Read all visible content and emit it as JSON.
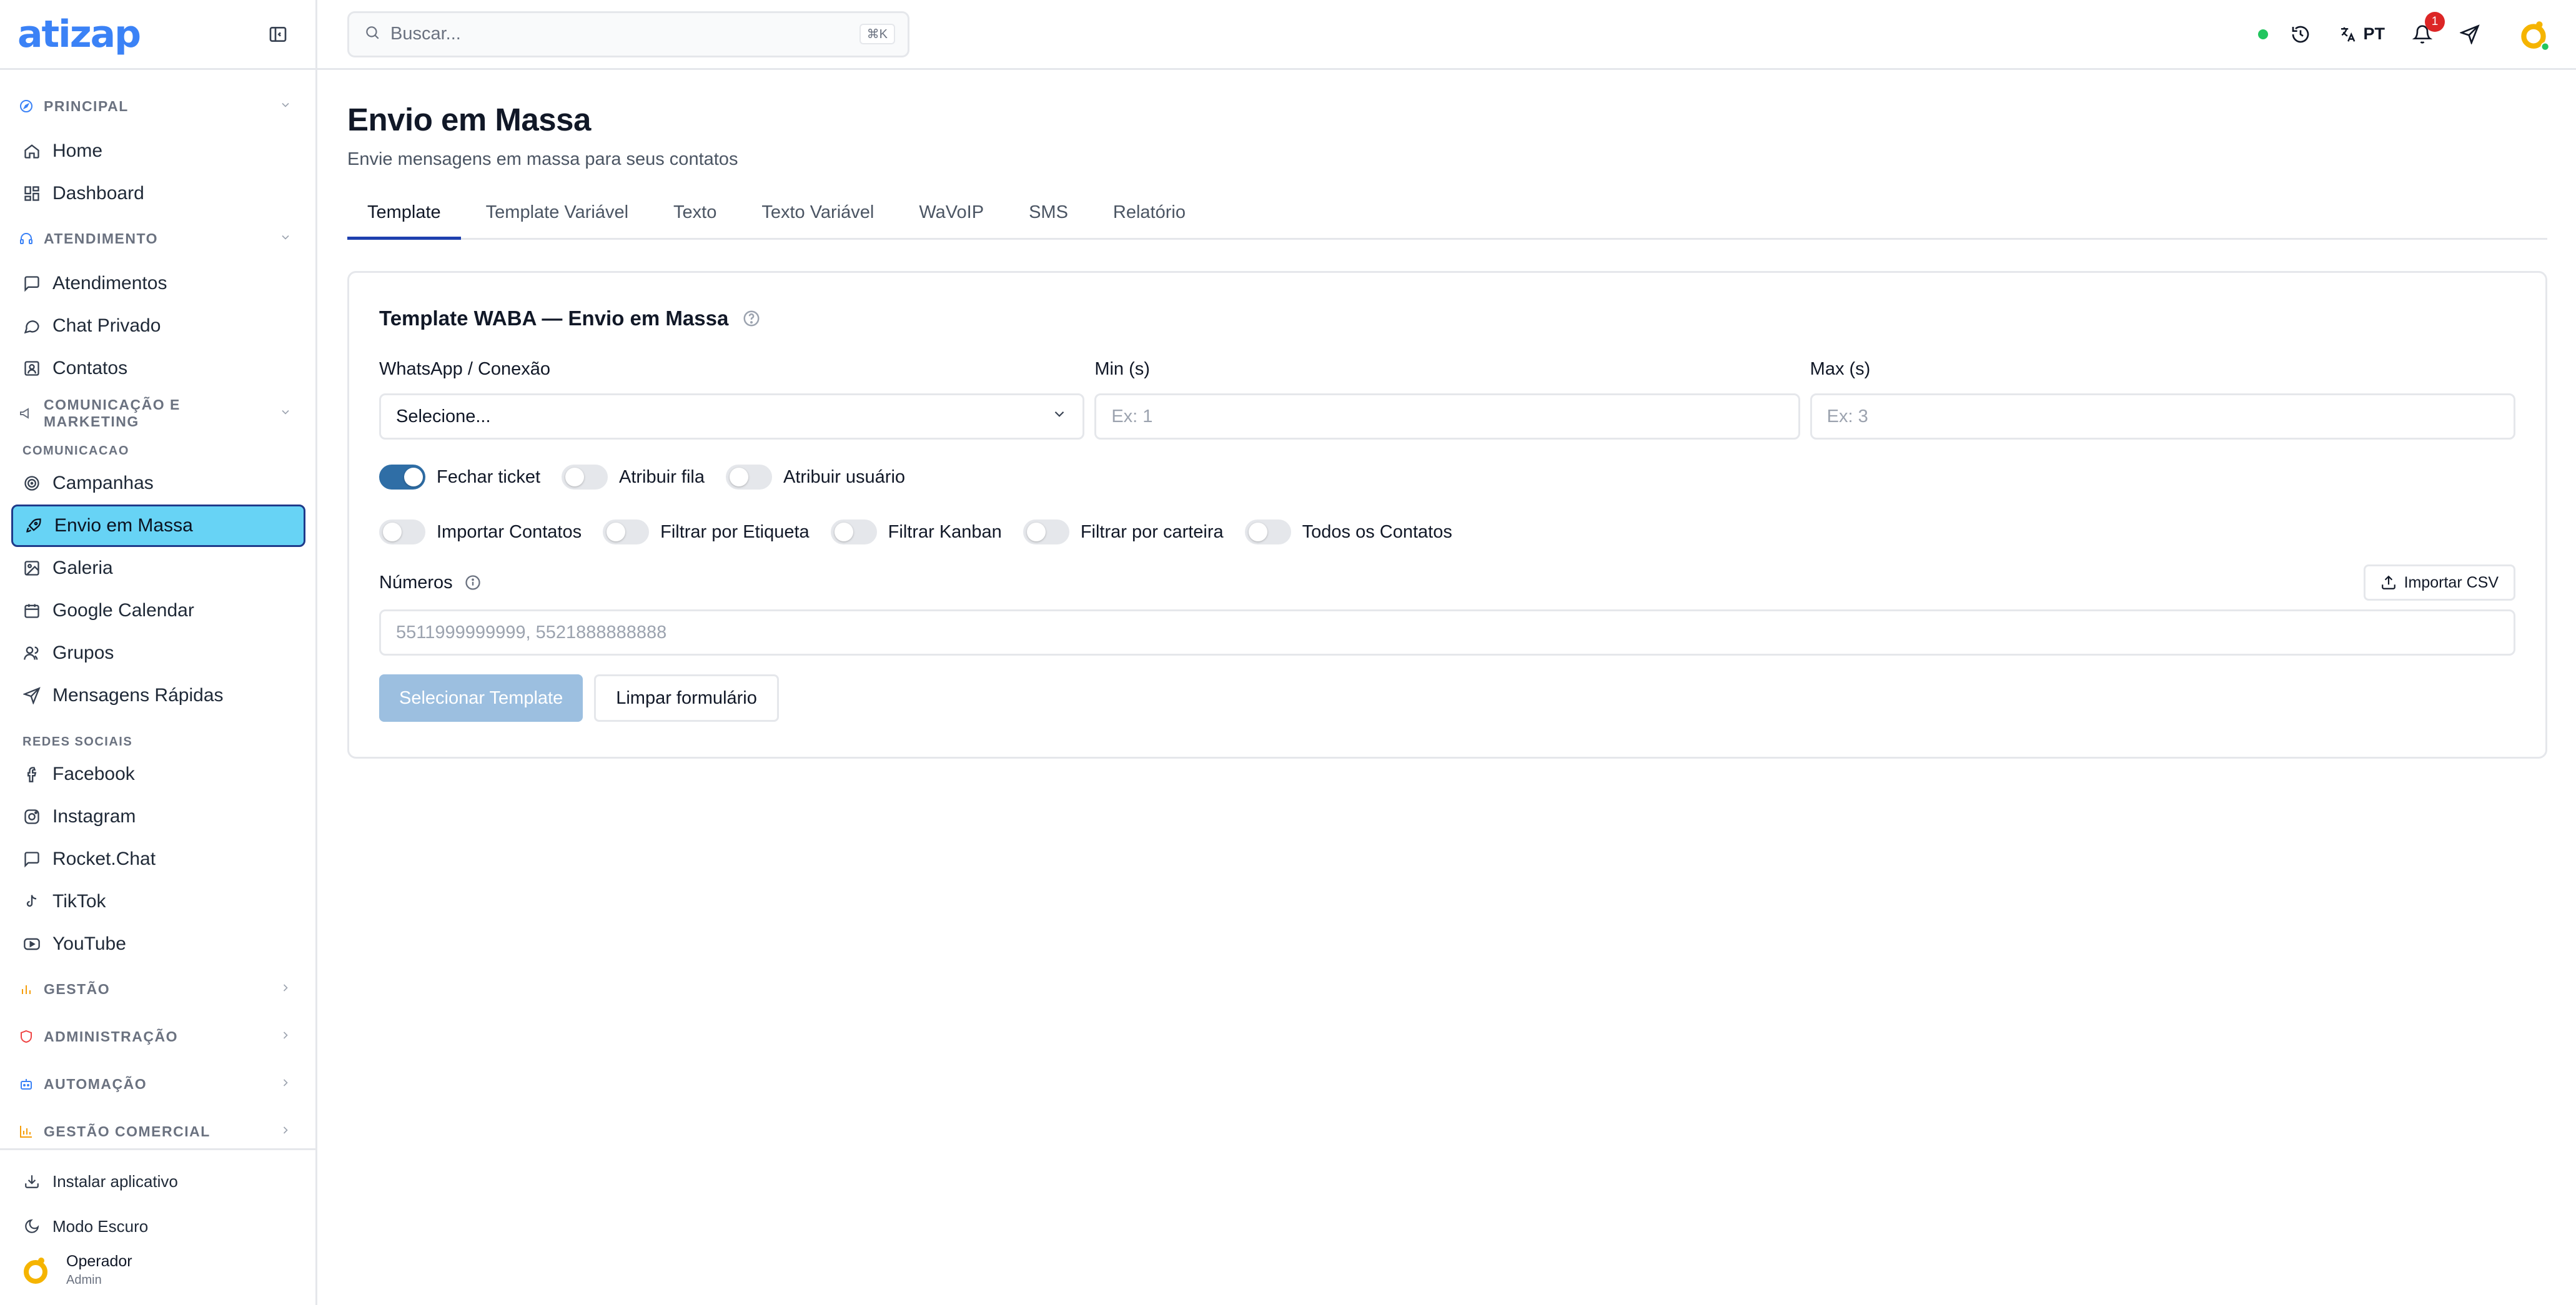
{
  "app": {
    "logo": "atizap"
  },
  "sidebar": {
    "sections": {
      "principal": "PRINCIPAL",
      "atendimento": "ATENDIMENTO",
      "comunicacao": "COMUNICAÇÃO E MARKETING",
      "gestao": "GESTÃO",
      "administracao": "ADMINISTRAÇÃO",
      "automacao": "AUTOMAÇÃO",
      "gestao_comercial": "GESTÃO COMERCIAL"
    },
    "subheaders": {
      "comunicacao": "COMUNICACAO",
      "redes_sociais": "REDES SOCIAIS"
    },
    "items": {
      "home": "Home",
      "dashboard": "Dashboard",
      "atendimentos": "Atendimentos",
      "chat_privado": "Chat Privado",
      "contatos": "Contatos",
      "campanhas": "Campanhas",
      "envio_em_massa": "Envio em Massa",
      "galeria": "Galeria",
      "google_calendar": "Google Calendar",
      "grupos": "Grupos",
      "mensagens_rapidas": "Mensagens Rápidas",
      "facebook": "Facebook",
      "instagram": "Instagram",
      "rocket_chat": "Rocket.Chat",
      "tiktok": "TikTok",
      "youtube": "YouTube"
    },
    "bottom": {
      "instalar": "Instalar aplicativo",
      "modo_escuro": "Modo Escuro",
      "user_name": "Operador",
      "user_role": "Admin"
    }
  },
  "topbar": {
    "search_placeholder": "Buscar...",
    "shortcut": "⌘K",
    "language": "PT",
    "notification_count": "1"
  },
  "page": {
    "title": "Envio em Massa",
    "subtitle": "Envie mensagens em massa para seus contatos"
  },
  "tabs": [
    "Template",
    "Template Variável",
    "Texto",
    "Texto Variável",
    "WaVoIP",
    "SMS",
    "Relatório"
  ],
  "form": {
    "card_title": "Template WABA — Envio em Massa",
    "whatsapp_label": "WhatsApp / Conexão",
    "whatsapp_value": "Selecione...",
    "min_label": "Min (s)",
    "min_placeholder": "Ex: 1",
    "max_label": "Max (s)",
    "max_placeholder": "Ex: 3",
    "toggles_row1": [
      {
        "label": "Fechar ticket",
        "on": true
      },
      {
        "label": "Atribuir fila",
        "on": false
      },
      {
        "label": "Atribuir usuário",
        "on": false
      }
    ],
    "toggles_row2": [
      {
        "label": "Importar Contatos",
        "on": false
      },
      {
        "label": "Filtrar por Etiqueta",
        "on": false
      },
      {
        "label": "Filtrar Kanban",
        "on": false
      },
      {
        "label": "Filtrar por carteira",
        "on": false
      },
      {
        "label": "Todos os Contatos",
        "on": false
      }
    ],
    "numeros_label": "Números",
    "import_csv": "Importar CSV",
    "numeros_placeholder": "5511999999999, 5521888888888",
    "btn_select": "Selecionar Template",
    "btn_clear": "Limpar formulário"
  },
  "colors": {
    "brand": "#3b82f6",
    "active_item": "#67d3f5",
    "toggle_on": "#2f6ea6",
    "primary_disabled": "#9cbfe0",
    "badge": "#dc2626",
    "status": "#22c55e"
  }
}
